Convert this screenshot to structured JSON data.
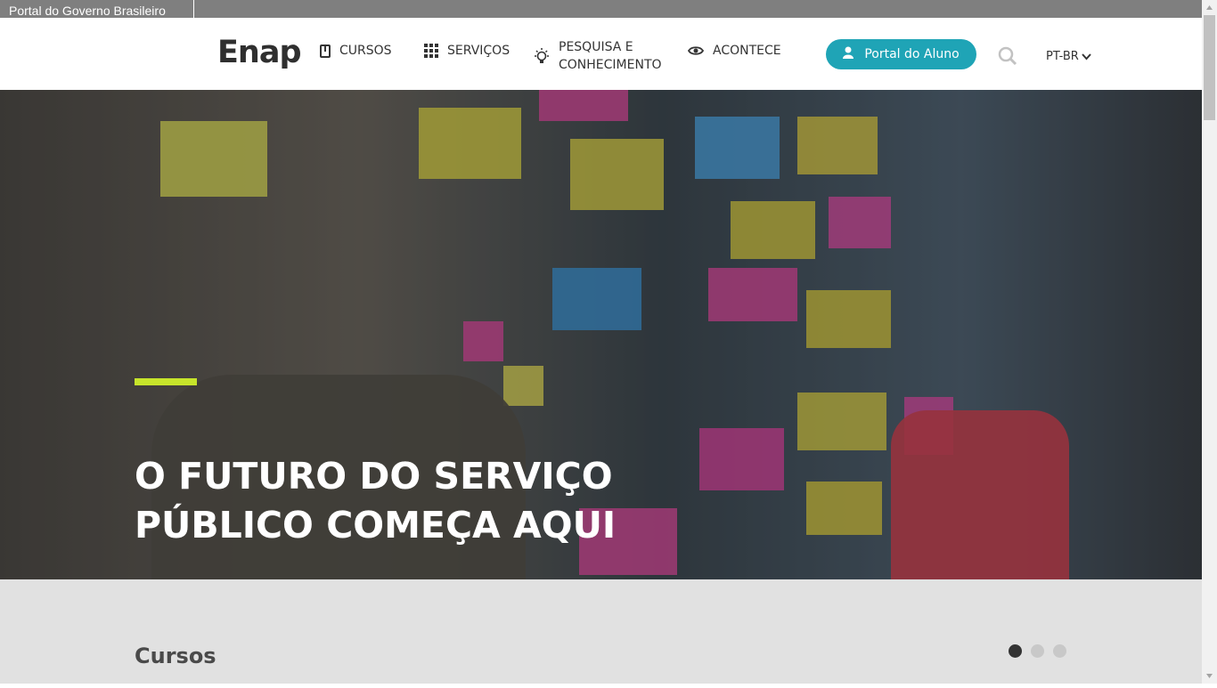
{
  "gov_bar": {
    "link": "Portal do Governo Brasileiro"
  },
  "header": {
    "logo": "Enap",
    "nav": [
      {
        "label": "CURSOS",
        "icon": "book-icon"
      },
      {
        "label": "SERVIÇOS",
        "icon": "grid-icon"
      },
      {
        "label_line1": "PESQUISA E",
        "label_line2": "CONHECIMENTO",
        "icon": "lightbulb-icon"
      },
      {
        "label": "ACONTECE",
        "icon": "eye-icon"
      }
    ],
    "portal_button": "Portal do Aluno",
    "language": "PT-BR"
  },
  "hero": {
    "title_line1": "O FUTURO DO SERVIÇO",
    "title_line2": "PÚBLICO COMEÇA AQUI"
  },
  "courses": {
    "title": "Cursos",
    "carousel_pages": 3,
    "active_page": 1
  },
  "colors": {
    "gov_bar": "#7f7f7f",
    "accent": "#1fa4b6",
    "hero_accent": "#c7e52b",
    "section_bg": "#e1e1e1"
  }
}
